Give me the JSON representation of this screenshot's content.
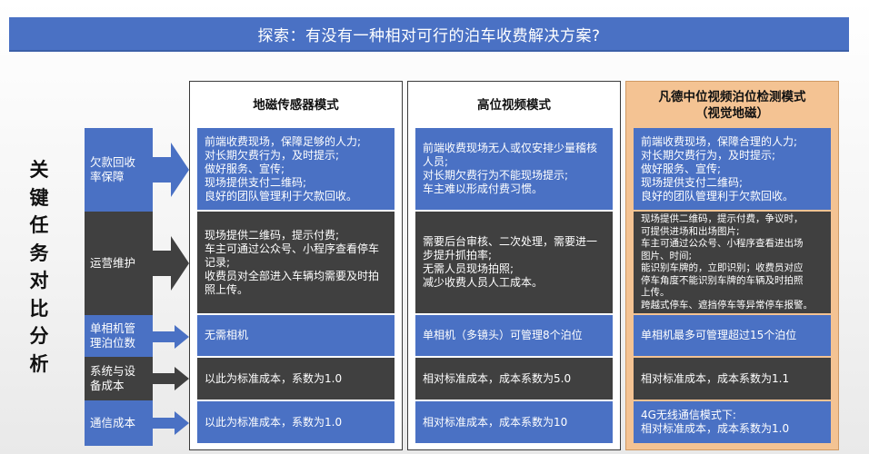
{
  "banner": {
    "title": "探索：有没有一种相对可行的泊车收费解决方案?"
  },
  "side_title": [
    "关",
    "键",
    "任",
    "务",
    "对",
    "比",
    "分",
    "析"
  ],
  "rows": [
    {
      "label": "欠款回收\n率保障"
    },
    {
      "label": "运营维护"
    },
    {
      "label": "单相机管\n理泊位数"
    },
    {
      "label": "系统与设\n备成本"
    },
    {
      "label": "通信成本"
    }
  ],
  "columns": [
    {
      "title": "地磁传感器模式",
      "subtitle": "",
      "cells": [
        "前端收费现场，保障足够的人力;\n对长期欠费行为，及时提示;\n做好服务、宣传;\n现场提供支付二维码;\n良好的团队管理利于欠款回收。",
        "现场提供二维码，提示付费;\n车主可通过公众号、小程序查看停车\n记录;\n收费员对全部进入车辆均需要及时拍\n照上传。",
        "无需相机",
        "以此为标准成本，系数为1.0",
        "以此为标准成本，系数为1.0"
      ]
    },
    {
      "title": "高位视频模式",
      "subtitle": "",
      "cells": [
        "前端收费现场无人或仅安排少量稽核\n人员;\n对长期欠费行为不能现场提示;\n车主难以形成付费习惯。",
        "需要后台审核、二次处理，需要进一\n步提升抓拍率;\n无需人员现场拍照;\n减少收费人员人工成本。",
        "单相机（多镜头）可管理8个泊位",
        "相对标准成本，成本系数为5.0",
        "相对标准成本，成本系数为10"
      ]
    },
    {
      "title": "凡德中位视频泊位检测模式",
      "subtitle": "（视觉地磁）",
      "cells": [
        "前端收费现场，保障合理的人力;\n对长期欠费行为，及时提示;\n做好服务、宣传;\n现场提供支付二维码;\n良好的团队管理利于欠款回收。",
        "现场提供二维码，提示付费，争议时，\n可提供进场和出场图片;\n车主可通过公众号、小程序查看进出场\n图片、时间;\n能识别车牌的，立即识别；收费员对应\n停车角度不能识别车牌的车辆及时拍照\n上传。\n跨越式停车、遮挡停车等异常停车报警。",
        "单相机最多可管理超过15个泊位",
        "相对标准成本，成本系数为1.1",
        "4G无线通信模式下:\n相对标准成本，成本系数为1.0"
      ]
    }
  ],
  "colors": {
    "blue": "#4a71c4",
    "dark": "#404040",
    "highlight": "#f4c393"
  }
}
